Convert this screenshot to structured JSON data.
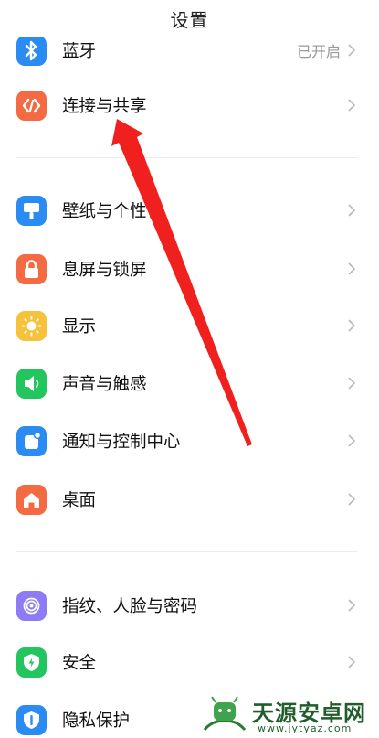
{
  "header": {
    "title": "设置"
  },
  "rows": {
    "bluetooth": {
      "label": "蓝牙",
      "value": "已开启",
      "icon": "bluetooth-icon",
      "color": "#2a8bf2"
    },
    "connection": {
      "label": "连接与共享",
      "icon": "connection-share-icon",
      "color": "#f46a42"
    },
    "wallpaper": {
      "label": "壁纸与个性化",
      "icon": "wallpaper-icon",
      "color": "#2a8bf2"
    },
    "lockscreen": {
      "label": "息屏与锁屏",
      "icon": "lock-icon",
      "color": "#f46a42"
    },
    "display": {
      "label": "显示",
      "icon": "sun-icon",
      "color": "#f7c23b"
    },
    "sound": {
      "label": "声音与触感",
      "icon": "speaker-icon",
      "color": "#22c55e"
    },
    "notifications": {
      "label": "通知与控制中心",
      "icon": "notification-icon",
      "color": "#2a8bf2"
    },
    "desktop": {
      "label": "桌面",
      "icon": "home-icon",
      "color": "#f46a42"
    },
    "fingerprint": {
      "label": "指纹、人脸与密码",
      "icon": "fingerprint-icon",
      "color": "#8b7cf6"
    },
    "security": {
      "label": "安全",
      "icon": "shield-icon",
      "color": "#22c55e"
    },
    "privacy": {
      "label": "隐私保护",
      "icon": "privacy-icon",
      "color": "#2a8bf2"
    }
  },
  "watermark": {
    "title": "天源安卓网",
    "url": "www.jytyaz.com"
  },
  "annotation": {
    "type": "red-arrow",
    "points_to": "连接与共享"
  }
}
